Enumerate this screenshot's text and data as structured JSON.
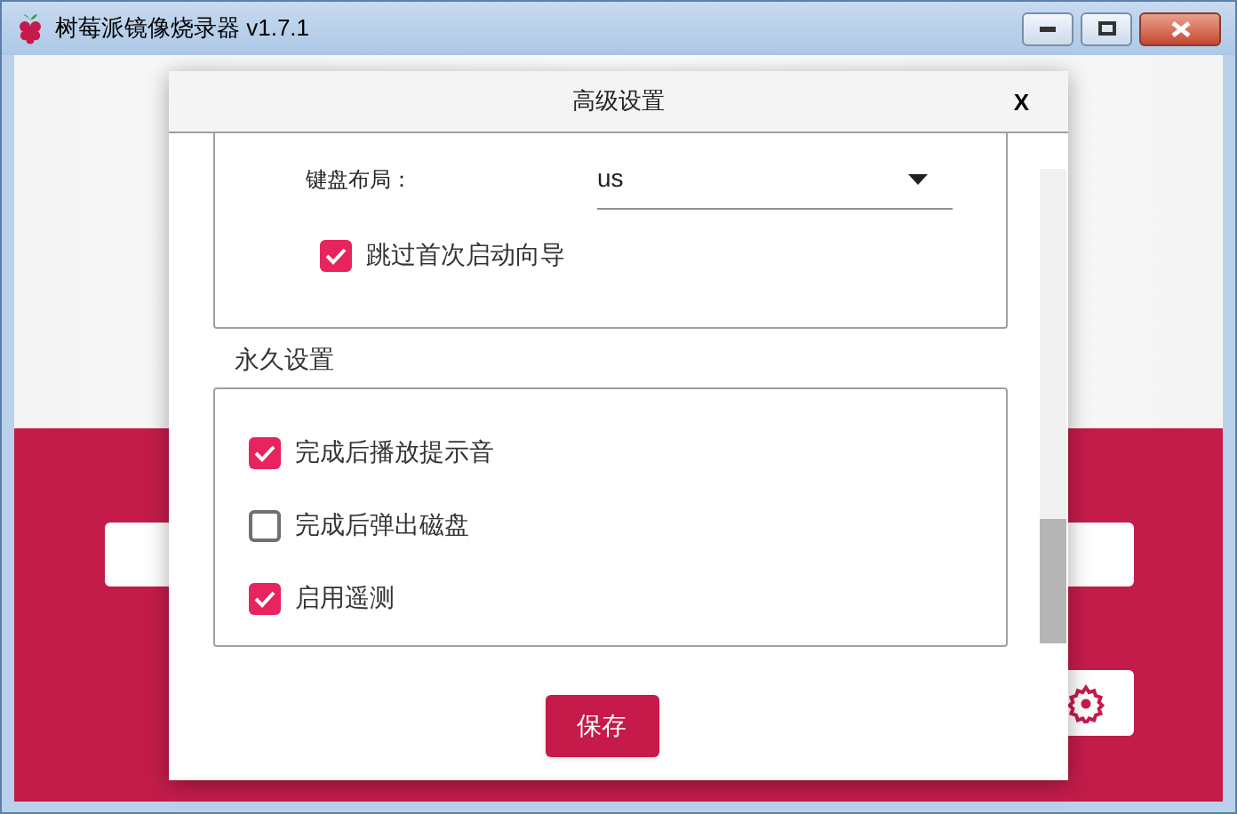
{
  "window": {
    "title": "树莓派镜像烧录器 v1.7.1"
  },
  "dialog": {
    "title": "高级设置",
    "close": "X",
    "keyboard": {
      "label": "键盘布局：",
      "value": "us"
    },
    "skip_wizard": {
      "label": "跳过首次启动向导",
      "checked": true
    },
    "persistent": {
      "title": "永久设置",
      "options": [
        {
          "label": "完成后播放提示音",
          "checked": true
        },
        {
          "label": "完成后弹出磁盘",
          "checked": false
        },
        {
          "label": "启用遥测",
          "checked": true
        }
      ]
    },
    "save": "保存"
  }
}
